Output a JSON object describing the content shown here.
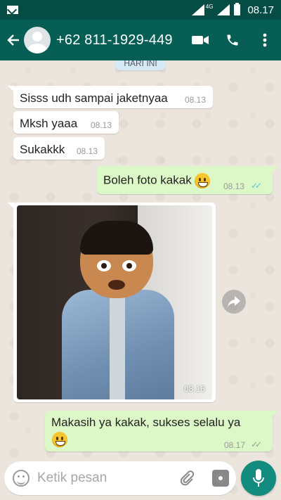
{
  "status_bar": {
    "network": "4G",
    "time": "08.17"
  },
  "header": {
    "contact": "+62 811-1929-449"
  },
  "chat": {
    "date_chip": "HARI INI",
    "messages": [
      {
        "dir": "in",
        "text": "Sisss udh sampai jaketnyaa",
        "time": "08.13"
      },
      {
        "dir": "in",
        "text": "Mksh yaaa",
        "time": "08.13"
      },
      {
        "dir": "in",
        "text": "Sukakkk",
        "time": "08.13"
      },
      {
        "dir": "out",
        "text": "Boleh foto kakak",
        "time": "08.13",
        "status": "read"
      },
      {
        "dir": "in",
        "type": "photo",
        "time": "08.16"
      },
      {
        "dir": "out",
        "text": "Makasih ya kakak, sukses selalu ya",
        "time": "08.17",
        "status": "delivered"
      }
    ]
  },
  "input": {
    "placeholder": "Ketik pesan"
  },
  "icons": {
    "back": "arrow-left-icon",
    "video": "video-call-icon",
    "call": "phone-icon",
    "menu": "more-vert-icon",
    "emoji": "emoji-icon",
    "attach": "paperclip-icon",
    "camera": "camera-icon",
    "mic": "microphone-icon",
    "forward": "share-icon"
  },
  "colors": {
    "header": "#075e54",
    "outgoing_bubble": "#dcf8c6",
    "read_ticks": "#4fc3f7",
    "mic_button": "#128c7e"
  }
}
